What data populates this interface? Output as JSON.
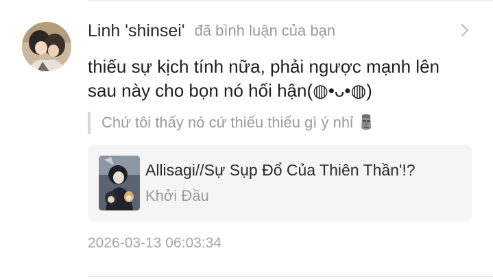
{
  "comment": {
    "author": "Linh 'shinsei'",
    "action_text": "đã bình luận của bạn",
    "body": "thiếu sự kịch tính nữa, phải ngược mạnh lên sau này cho bọn nó hối hận(◍•ᴗ•◍)",
    "quoted_reply": "Chứ tôi thấy nó cứ thiếu thiếu gì ý nhỉ",
    "quoted_emoji": "moai-icon",
    "timestamp": "2026-03-13 06:03:34"
  },
  "story_card": {
    "title": "Allisagi//Sự Sụp Đổ Của Thiên Thần'!?",
    "chapter": "Khởi Đầu"
  },
  "icons": {
    "chevron": "chevron-right-icon",
    "avatar": "avatar",
    "cover": "book-cover"
  },
  "colors": {
    "primary_text": "#1f1f1f",
    "secondary_text": "#9a9a9a",
    "card_background": "#f5f5f5",
    "quote_bar": "#d6d6d6"
  }
}
